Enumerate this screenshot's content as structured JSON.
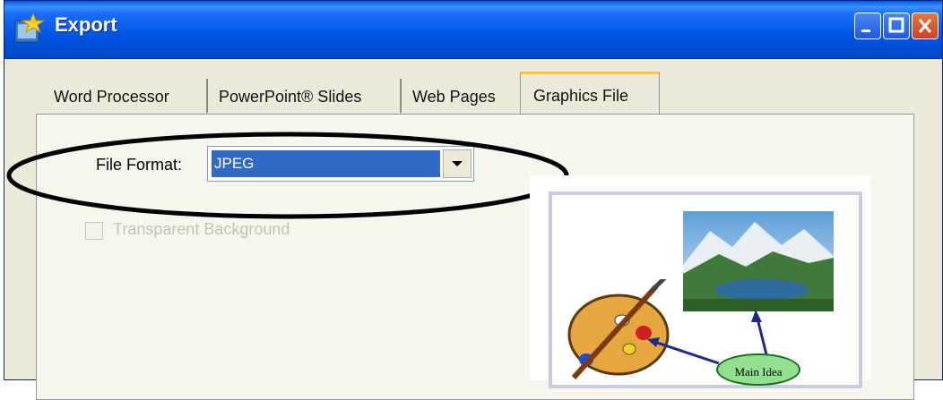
{
  "window": {
    "title": "Export",
    "icon": "star-app-icon"
  },
  "caption_buttons": [
    "minimize",
    "maximize",
    "close"
  ],
  "tabs": [
    {
      "label": "Word Processor",
      "active": false
    },
    {
      "label": "PowerPoint® Slides",
      "active": false
    },
    {
      "label": "Web Pages",
      "active": false
    },
    {
      "label": "Graphics File",
      "active": true
    }
  ],
  "file_format": {
    "label": "File Format:",
    "value": "JPEG"
  },
  "transparent_background": {
    "label": "Transparent Background",
    "checked": false,
    "enabled": false
  },
  "preview": {
    "node_label": "Main Idea"
  },
  "colors": {
    "titlebar": "#0055e5",
    "selection": "#316ac5",
    "dialog_bg": "#ece9d8",
    "highlight_ellipse": "#000000"
  }
}
